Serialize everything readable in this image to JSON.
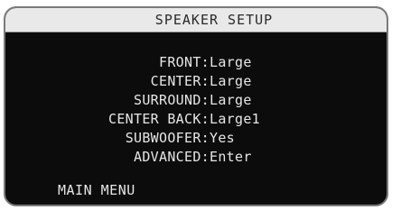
{
  "title": "SPEAKER SETUP",
  "items": [
    {
      "label": "FRONT:",
      "value": "Large"
    },
    {
      "label": "CENTER:",
      "value": "Large"
    },
    {
      "label": "SURROUND:",
      "value": "Large"
    },
    {
      "label": "CENTER BACK:",
      "value": "Large1"
    },
    {
      "label": "SUBWOOFER:",
      "value": "Yes"
    },
    {
      "label": "ADVANCED:",
      "value": "Enter"
    }
  ],
  "footer": {
    "main_menu": "MAIN MENU"
  },
  "colors": {
    "screen_background": "#0c0c0c",
    "title_bar": "#e9e9e9",
    "text": "#e6e6e6",
    "bezel": "#7a7a7a"
  }
}
